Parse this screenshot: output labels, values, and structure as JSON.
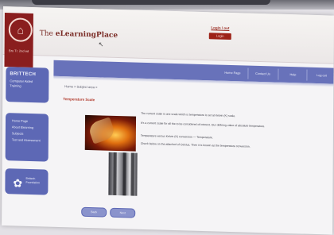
{
  "header": {
    "brand_prefix": "The ",
    "brand_name": "eLearningPlace",
    "login_link": "Login / out",
    "login_button": "Login",
    "logo_caption": "Bru Tr. 2nd ed"
  },
  "sidebar": {
    "title": "BRITTECH",
    "subtitle_1": "Computer Aided",
    "subtitle_2": "Training",
    "items": [
      {
        "label": "Home Page"
      },
      {
        "label": "About Elearning"
      },
      {
        "label": "Subjects"
      },
      {
        "label": "Test and Assessment"
      }
    ],
    "footer_1": "Brittech",
    "footer_2": "Foundation"
  },
  "navbar": {
    "items": [
      {
        "label": "Home Page"
      },
      {
        "label": "Contact Us"
      },
      {
        "label": "Help"
      },
      {
        "label": "Log out"
      }
    ]
  },
  "content": {
    "breadcrumb": "Home > Subject area >",
    "section_title": "Temperature Scale",
    "paragraphs": [
      "The current scale is one scale which is temperature is set at Kelvin (K) scale.",
      "It's a current scale for all the to be considered of interest. Our defining value of absolute temperature.",
      "Temperature versus Kelvin (K) conversion — Temperature.",
      "Check below on the attached of Celsius, Then it is known as the temperature conversion."
    ],
    "back_button": "Back",
    "next_button": "Next"
  }
}
